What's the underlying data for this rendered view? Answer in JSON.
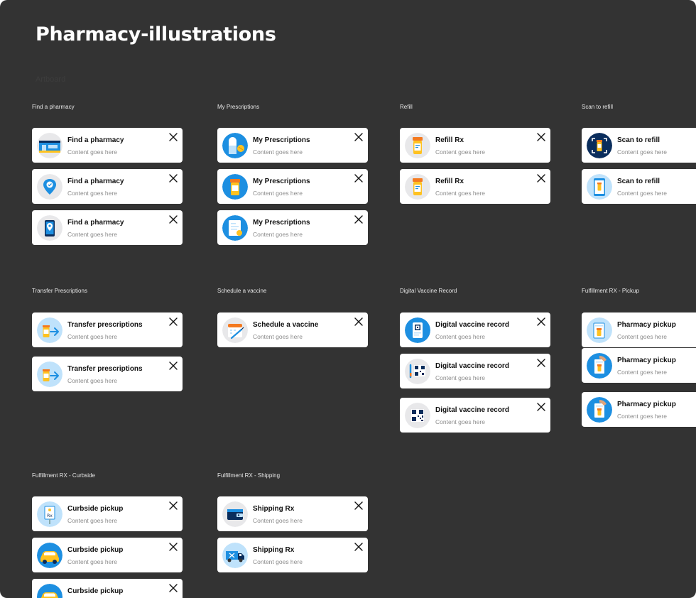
{
  "page": {
    "title": "Pharmacy-illustrations",
    "faint_label": "Artboard"
  },
  "card_subtitle": "Content goes here",
  "sections": [
    {
      "label": "Find a pharmacy",
      "cards": [
        {
          "title": "Find a pharmacy",
          "icon": "storefront-icon"
        },
        {
          "title": "Find a pharmacy",
          "icon": "map-pin-icon"
        },
        {
          "title": "Find a pharmacy",
          "icon": "phone-location-icon"
        }
      ]
    },
    {
      "label": "My Prescriptions",
      "cards": [
        {
          "title": "My Prescriptions",
          "icon": "pill-capsule-icon"
        },
        {
          "title": "My Prescriptions",
          "icon": "pill-bottle-icon"
        },
        {
          "title": "My Prescriptions",
          "icon": "prescription-list-icon"
        }
      ]
    },
    {
      "label": "Refill",
      "cards": [
        {
          "title": "Refill Rx",
          "icon": "refill-bottle-icon"
        },
        {
          "title": "Refill Rx",
          "icon": "refill-bottle-icon"
        }
      ]
    },
    {
      "label": "Scan to refill",
      "cards": [
        {
          "title": "Scan to refill",
          "icon": "scan-bottle-icon"
        },
        {
          "title": "Scan to refill",
          "icon": "scan-phone-icon"
        }
      ]
    },
    {
      "label": "Transfer Prescriptions",
      "cards": [
        {
          "title": "Transfer prescriptions",
          "icon": "transfer-arrow-icon"
        },
        {
          "title": "Transfer prescriptions",
          "icon": "transfer-arrow-icon"
        }
      ]
    },
    {
      "label": "Schedule a vaccine",
      "cards": [
        {
          "title": "Schedule a vaccine",
          "icon": "calendar-syringe-icon"
        }
      ]
    },
    {
      "label": "Digital Vaccine Record",
      "cards": [
        {
          "title": "Digital vaccine record",
          "icon": "vaccine-card-icon"
        },
        {
          "title": "Digital vaccine record",
          "icon": "qr-syringe-icon"
        },
        {
          "title": "Digital vaccine record",
          "icon": "qr-code-icon"
        }
      ]
    },
    {
      "label": "Fulfillment RX - Pickup",
      "cards": [
        {
          "title": "Pharmacy pickup",
          "icon": "pickup-bag-icon"
        },
        {
          "title": "Pharmacy pickup",
          "icon": "pickup-hand-icon"
        },
        {
          "title": "Pharmacy pickup",
          "icon": "pickup-hand-icon"
        }
      ]
    },
    {
      "label": "Fulfillment RX - Curbside",
      "cards": [
        {
          "title": "Curbside pickup",
          "icon": "curbside-sign-icon"
        },
        {
          "title": "Curbside pickup",
          "icon": "car-icon"
        },
        {
          "title": "Curbside pickup",
          "icon": "car-icon"
        }
      ]
    },
    {
      "label": "Fulfillment RX - Shipping",
      "cards": [
        {
          "title": "Shipping Rx",
          "icon": "shipping-wallet-icon"
        },
        {
          "title": "Shipping Rx",
          "icon": "delivery-truck-icon"
        }
      ]
    }
  ],
  "colors": {
    "background": "#333333",
    "card": "#ffffff",
    "accent_blue": "#1d8fe1",
    "accent_light_blue": "#bfe2fb",
    "accent_yellow": "#ffc220",
    "accent_orange": "#f47a20",
    "navy": "#0a2d5c"
  }
}
